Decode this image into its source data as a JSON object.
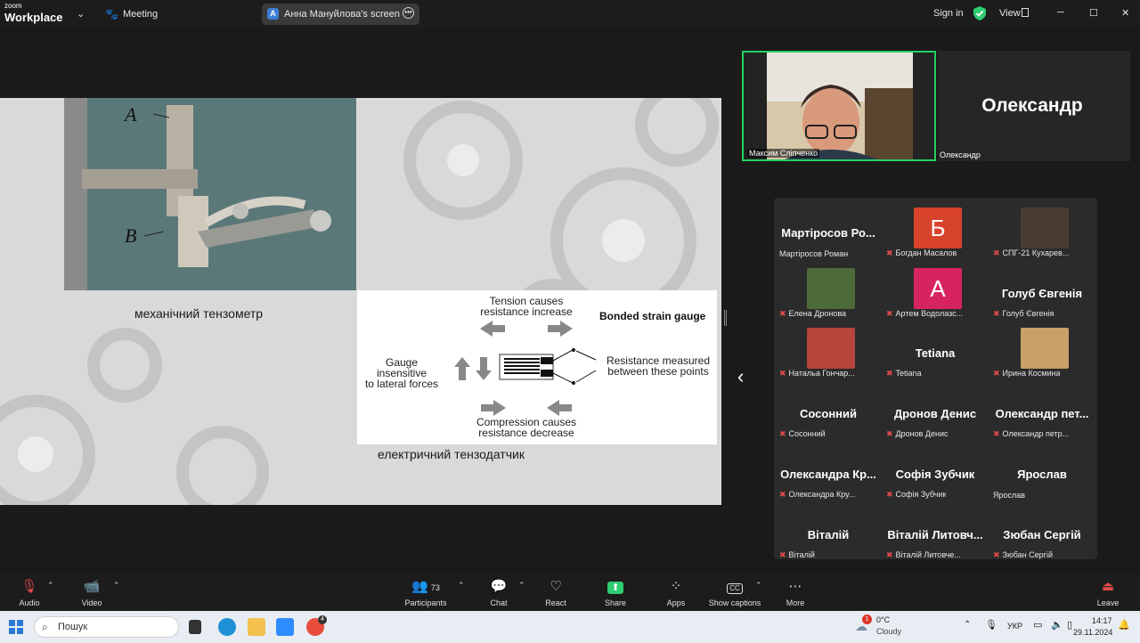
{
  "titlebar": {
    "logo_top": "zoom",
    "logo_bottom": "Workplace",
    "meeting_label": "Meeting",
    "screen_badge": "A",
    "screen_label": "Анна Мануйлова's screen",
    "sign_in": "Sign in",
    "view": "View",
    "minimize": "─",
    "maximize": "☐",
    "close": "✕"
  },
  "slide": {
    "photo_label_a": "A",
    "photo_label_b": "B",
    "caption_left": "механічний тензометр",
    "caption_right": "електричний тензодатчик",
    "diagram": {
      "title": "Bonded strain gauge",
      "tension_line1": "Tension causes",
      "tension_line2": "resistance increase",
      "compression_line1": "Compression causes",
      "compression_line2": "resistance decrease",
      "left_line1": "Gauge insensitive",
      "left_line2": "to lateral forces",
      "right_line1": "Resistance measured",
      "right_line2": "between these points"
    }
  },
  "video": {
    "active_name": "Максим Сліпченко",
    "alex_big": "Олександр",
    "alex_label": "Олександр",
    "prev_arrow": "‹"
  },
  "gallery": [
    {
      "big": "Мартіросов Ро...",
      "label": "Мартіросов Роман",
      "muted": false,
      "avatar": null
    },
    {
      "big": "",
      "label": "Богдан Масалов",
      "muted": true,
      "avatar": "Б",
      "avatar_color": "#d8432b"
    },
    {
      "big": "",
      "label": "СПГ-21 Кухарев...",
      "muted": true,
      "avatar": "",
      "avatar_color": "#4a3b32"
    },
    {
      "big": "",
      "label": "Елена Дронова",
      "muted": true,
      "avatar": "",
      "avatar_color": "#4e6a3a"
    },
    {
      "big": "",
      "label": "Артем Водолазс...",
      "muted": true,
      "avatar": "А",
      "avatar_color": "#d8245e"
    },
    {
      "big": "Голуб Євгенія",
      "label": "Голуб Євгенія",
      "muted": true,
      "avatar": null
    },
    {
      "big": "",
      "label": "Натальа Гончар...",
      "muted": true,
      "avatar": "",
      "avatar_color": "#b5443a"
    },
    {
      "big": "Tetiana",
      "label": "Tetiana",
      "muted": true,
      "avatar": null
    },
    {
      "big": "",
      "label": "Ирина Космина",
      "muted": true,
      "avatar": "",
      "avatar_color": "#c9a067"
    },
    {
      "big": "Сосонний",
      "label": "Сосонний",
      "muted": true,
      "avatar": null
    },
    {
      "big": "Дронов Денис",
      "label": "Дронов Денис",
      "muted": true,
      "avatar": null
    },
    {
      "big": "Олександр пет...",
      "label": "Олександр петр...",
      "muted": true,
      "avatar": null
    },
    {
      "big": "Олександра Кр...",
      "label": "Олександра Кру...",
      "muted": true,
      "avatar": null
    },
    {
      "big": "Софія Зубчик",
      "label": "Софія Зубчик",
      "muted": true,
      "avatar": null
    },
    {
      "big": "Ярослав",
      "label": "Ярослав",
      "muted": false,
      "avatar": null
    },
    {
      "big": "Віталій",
      "label": "Віталій",
      "muted": true,
      "avatar": null
    },
    {
      "big": "Віталій Литовч...",
      "label": "Віталій Литовче...",
      "muted": true,
      "avatar": null
    },
    {
      "big": "Зюбан Сергій",
      "label": "Зюбан Сергій",
      "muted": true,
      "avatar": null
    }
  ],
  "toolbar": {
    "audio": "Audio",
    "video": "Video",
    "participants": "Participants",
    "participants_count": "73",
    "chat": "Chat",
    "react": "React",
    "share": "Share",
    "apps": "Apps",
    "captions": "Show captions",
    "more": "More",
    "leave": "Leave"
  },
  "taskbar": {
    "search_placeholder": "Пошук",
    "weather_badge": "1",
    "weather_temp": "0°C",
    "weather_desc": "Cloudy",
    "lang": "УКР",
    "time": "14:17",
    "date": "29.11.2024",
    "chrome_badge": "4"
  },
  "colors": {
    "accent_green": "#23d160",
    "share_green": "#2ecc71",
    "muted_red": "#e04a4a"
  }
}
